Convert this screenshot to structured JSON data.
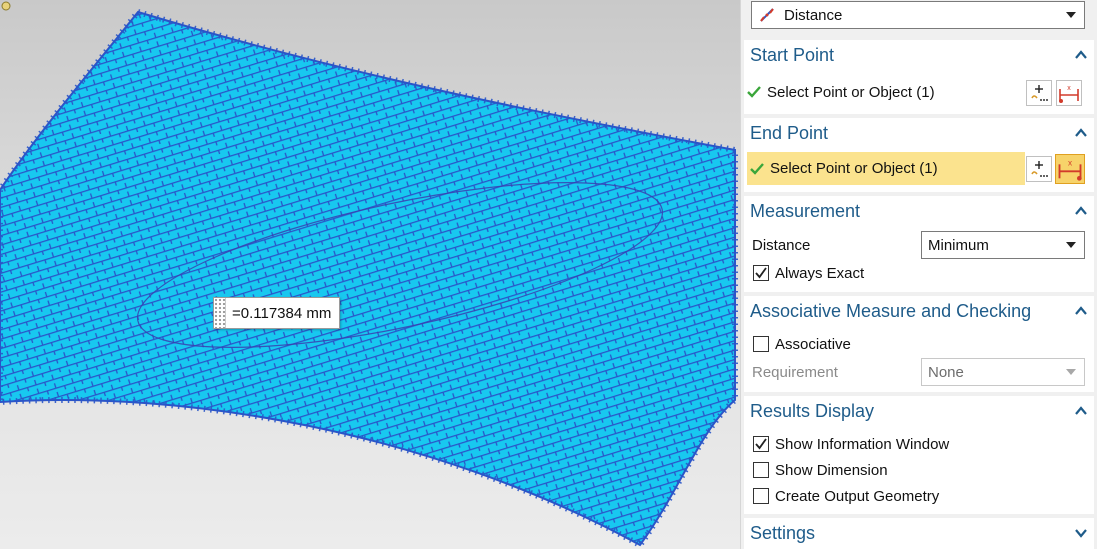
{
  "viewport": {
    "measurement_tooltip": "=0.117384 mm"
  },
  "panel": {
    "type_dropdown": {
      "value": "Distance",
      "icon": "distance-measure-icon"
    },
    "start_point": {
      "title": "Start Point",
      "select_label": "Select Point or Object (1)",
      "status_icon": "checkmark-icon",
      "buttons": [
        "point-dialog-icon",
        "point-on-curve-icon"
      ]
    },
    "end_point": {
      "title": "End Point",
      "select_label": "Select Point or Object (1)",
      "status_icon": "checkmark-icon",
      "buttons": [
        "point-dialog-icon",
        "point-on-curve-icon"
      ]
    },
    "measurement": {
      "title": "Measurement",
      "distance_label": "Distance",
      "distance_value": "Minimum",
      "always_exact_label": "Always Exact",
      "always_exact_checked": true
    },
    "associative": {
      "title": "Associative Measure and Checking",
      "associative_label": "Associative",
      "associative_checked": false,
      "requirement_label": "Requirement",
      "requirement_value": "None"
    },
    "results": {
      "title": "Results Display",
      "show_info_label": "Show Information Window",
      "show_info_checked": true,
      "show_dimension_label": "Show Dimension",
      "show_dimension_checked": false,
      "create_output_label": "Create Output Geometry",
      "create_output_checked": false
    },
    "settings": {
      "title": "Settings",
      "expanded": false
    }
  },
  "colors": {
    "mesh_fill": "#18c8f0",
    "mesh_lines": "#2a55c8",
    "section_title": "#1f5c8a",
    "highlight": "#fbe38e",
    "check_green": "#3aa63a"
  }
}
